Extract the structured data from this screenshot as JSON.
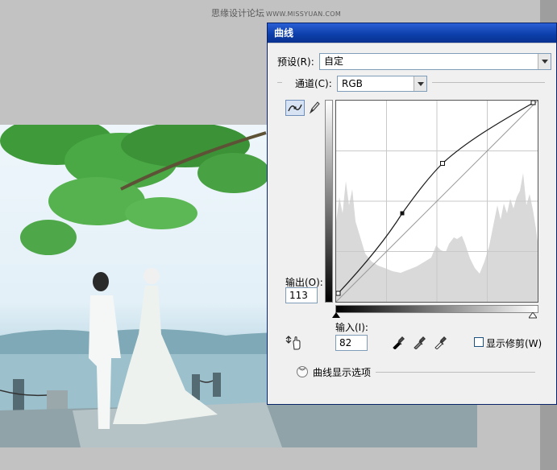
{
  "watermark": {
    "site": "思缘设计论坛",
    "url": "WWW.MISSYUAN.COM"
  },
  "dialog": {
    "title": "曲线",
    "preset": {
      "label": "预设(R):",
      "value": "自定"
    },
    "channel": {
      "label": "通道(C):",
      "value": "RGB"
    },
    "output": {
      "label": "输出(O):",
      "value": "113"
    },
    "input": {
      "label": "输入(I):",
      "value": "82"
    },
    "show_clipping": {
      "label": "显示修剪(W)",
      "checked": false
    },
    "curve_display_options": "曲线显示选项",
    "colors": {
      "title_bar": "#0b3ea8",
      "graph_bg": "#ffffff",
      "histogram": "#d9d9d9"
    }
  },
  "icons": {
    "curve_tool": "curve-point-icon",
    "pencil_tool": "pencil-icon",
    "adjust_tool": "hand-adjust-icon",
    "black_eyedropper": "eyedropper-black-icon",
    "gray_eyedropper": "eyedropper-gray-icon",
    "white_eyedropper": "eyedropper-white-icon",
    "expand": "double-chevron-down-icon"
  }
}
